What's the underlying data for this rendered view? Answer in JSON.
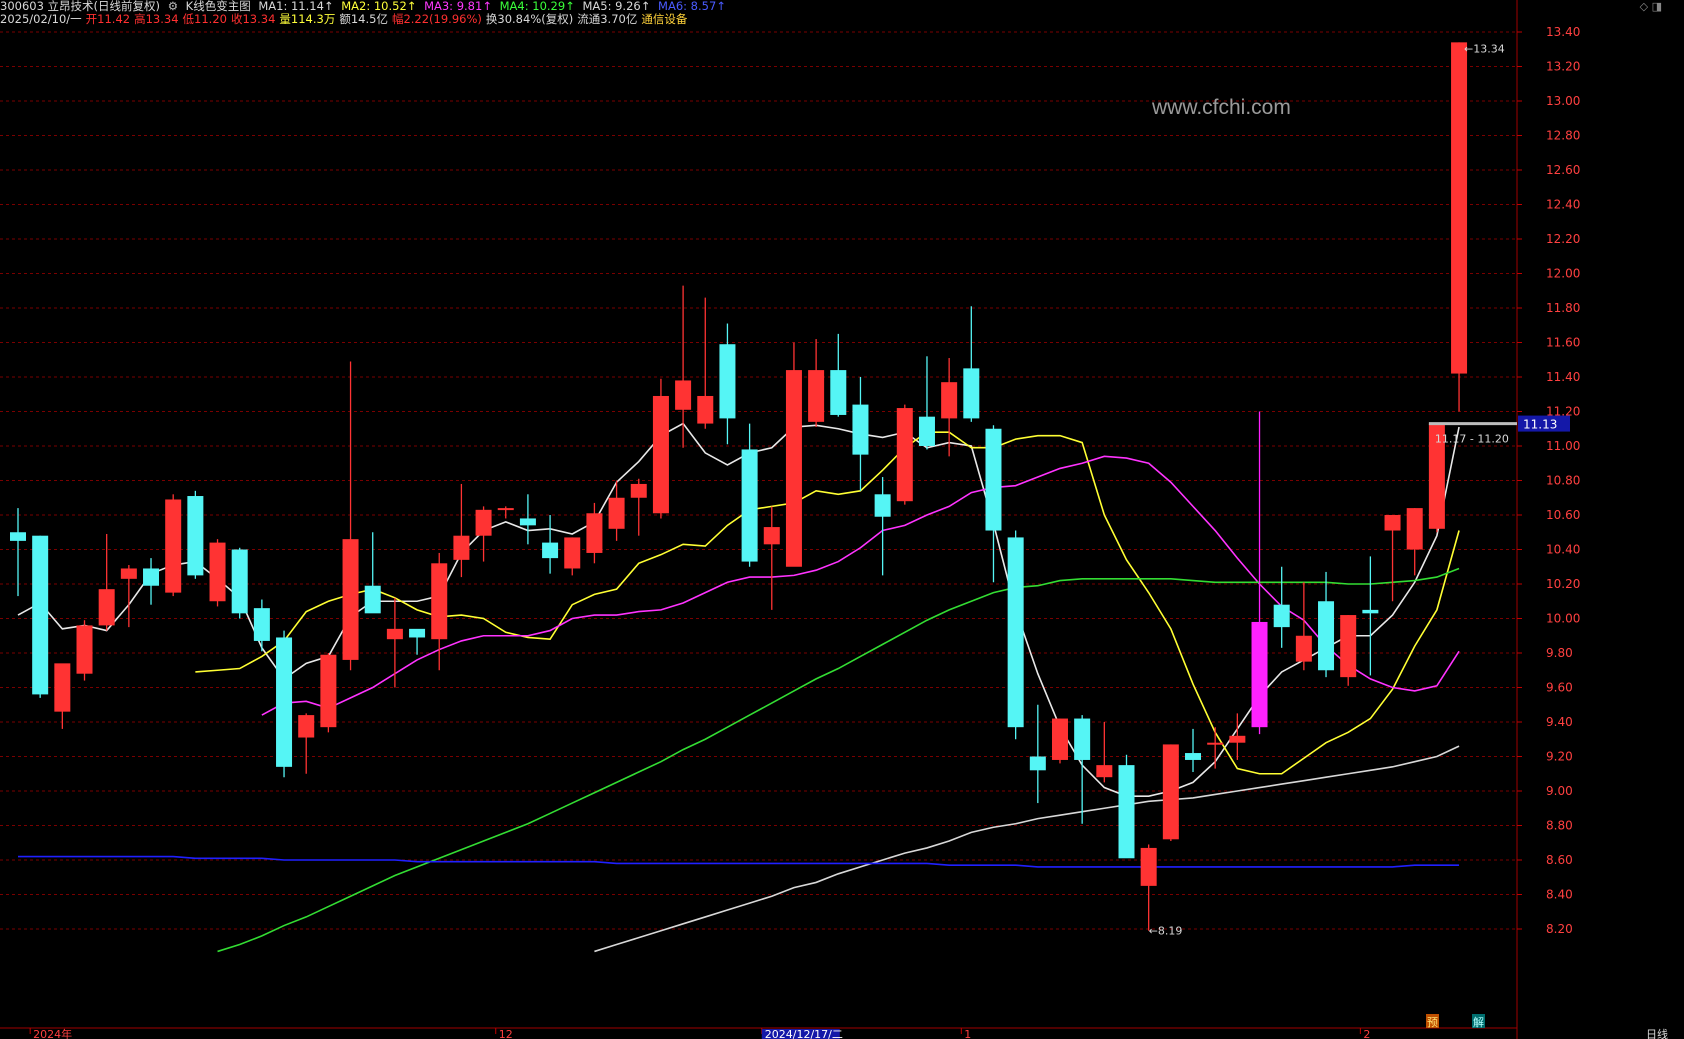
{
  "header": {
    "code_name": "300603 立昂技术(日线前复权)",
    "indicator_name": "K线色变主图",
    "ma_labels": [
      {
        "text": "MA1: 11.14↑",
        "color": "#d8d8d8"
      },
      {
        "text": "MA2: 10.52↑",
        "color": "#ffff3a"
      },
      {
        "text": "MA3: 9.81↑",
        "color": "#ff3aff"
      },
      {
        "text": "MA4: 10.29↑",
        "color": "#3aff3a"
      },
      {
        "text": "MA5: 9.26↑",
        "color": "#d8d8d8"
      },
      {
        "text": "MA6: 8.57↑",
        "color": "#4a5bff"
      }
    ],
    "date": "2025/02/10/一",
    "open": "开11.42",
    "high": "高13.34",
    "low": "低11.20",
    "close": "收13.34",
    "volume": "量114.3万",
    "amount": "额14.5亿",
    "change": "幅2.22(19.96%)",
    "turnover": "换30.84%(复权)",
    "float": "流通3.70亿",
    "sector": "通信设备"
  },
  "corner_icon": "diamond-icon",
  "watermark": "www.cfchi.com",
  "period_label": "日线",
  "colors": {
    "up": "#ff3333",
    "down": "#55f5f5",
    "special_up": "#ff22ff",
    "grid": "#7a0000",
    "axis_text": "#ff4040",
    "ma1": "#e8e8e8",
    "ma2": "#ffff33",
    "ma3": "#ff33ff",
    "ma4": "#33dd33",
    "ma5": "#d8d8d8",
    "ma6": "#2020ff"
  },
  "chart_data": {
    "type": "candlestick",
    "ylim": [
      8.1,
      13.5
    ],
    "y_ticks": [
      "13.40",
      "13.20",
      "13.00",
      "12.80",
      "12.60",
      "12.40",
      "12.20",
      "12.00",
      "11.80",
      "11.60",
      "11.40",
      "11.20",
      "11.00",
      "10.80",
      "10.60",
      "10.40",
      "10.20",
      "10.00",
      "9.80",
      "9.60",
      "9.40",
      "9.20",
      "9.00",
      "8.80",
      "8.60",
      "8.40",
      "8.20"
    ],
    "x_labels": [
      {
        "text": "2024年",
        "index": 1
      },
      {
        "text": "12",
        "index": 22
      },
      {
        "text": "2024/12/17/二",
        "index": 34
      },
      {
        "text": "1",
        "index": 43
      },
      {
        "text": "2",
        "index": 61
      }
    ],
    "annotations": {
      "high_marker": "13.34",
      "low_marker": "8.19",
      "current_price": "11.13",
      "range_text": "11.17 - 11.20",
      "badge_yu": "预",
      "badge_jie": "解"
    },
    "candles": [
      {
        "o": 10.5,
        "h": 10.64,
        "l": 10.13,
        "c": 10.45
      },
      {
        "o": 10.48,
        "h": 10.48,
        "l": 9.54,
        "c": 9.56
      },
      {
        "o": 9.46,
        "h": 9.73,
        "l": 9.36,
        "c": 9.74
      },
      {
        "o": 9.68,
        "h": 9.99,
        "l": 9.64,
        "c": 9.96
      },
      {
        "o": 9.96,
        "h": 10.49,
        "l": 9.93,
        "c": 10.17
      },
      {
        "o": 10.23,
        "h": 10.31,
        "l": 9.95,
        "c": 10.29
      },
      {
        "o": 10.29,
        "h": 10.35,
        "l": 10.08,
        "c": 10.19
      },
      {
        "o": 10.15,
        "h": 10.72,
        "l": 10.13,
        "c": 10.69
      },
      {
        "o": 10.71,
        "h": 10.74,
        "l": 10.23,
        "c": 10.25
      },
      {
        "o": 10.1,
        "h": 10.46,
        "l": 10.07,
        "c": 10.44
      },
      {
        "o": 10.4,
        "h": 10.41,
        "l": 10.0,
        "c": 10.03
      },
      {
        "o": 10.06,
        "h": 10.11,
        "l": 9.81,
        "c": 9.87
      },
      {
        "o": 9.89,
        "h": 9.93,
        "l": 9.08,
        "c": 9.14
      },
      {
        "o": 9.31,
        "h": 9.45,
        "l": 9.1,
        "c": 9.44
      },
      {
        "o": 9.37,
        "h": 9.8,
        "l": 9.34,
        "c": 9.79
      },
      {
        "o": 9.76,
        "h": 11.49,
        "l": 9.7,
        "c": 10.46
      },
      {
        "o": 10.19,
        "h": 10.5,
        "l": 10.04,
        "c": 10.03
      },
      {
        "o": 9.88,
        "h": 10.12,
        "l": 9.6,
        "c": 9.94
      },
      {
        "o": 9.94,
        "h": 9.91,
        "l": 9.79,
        "c": 9.89
      },
      {
        "o": 9.88,
        "h": 10.38,
        "l": 9.7,
        "c": 10.32
      },
      {
        "o": 10.34,
        "h": 10.78,
        "l": 10.24,
        "c": 10.48
      },
      {
        "o": 10.48,
        "h": 10.65,
        "l": 10.33,
        "c": 10.63
      },
      {
        "o": 10.63,
        "h": 10.65,
        "l": 10.58,
        "c": 10.64
      },
      {
        "o": 10.58,
        "h": 10.72,
        "l": 10.43,
        "c": 10.54
      },
      {
        "o": 10.44,
        "h": 10.6,
        "l": 10.26,
        "c": 10.35
      },
      {
        "o": 10.29,
        "h": 10.47,
        "l": 10.25,
        "c": 10.47
      },
      {
        "o": 10.38,
        "h": 10.67,
        "l": 10.32,
        "c": 10.61
      },
      {
        "o": 10.52,
        "h": 10.8,
        "l": 10.45,
        "c": 10.7
      },
      {
        "o": 10.7,
        "h": 10.81,
        "l": 10.48,
        "c": 10.78
      },
      {
        "o": 10.61,
        "h": 11.39,
        "l": 10.58,
        "c": 11.29
      },
      {
        "o": 11.21,
        "h": 11.93,
        "l": 10.99,
        "c": 11.38
      },
      {
        "o": 11.13,
        "h": 11.86,
        "l": 11.1,
        "c": 11.29
      },
      {
        "o": 11.59,
        "h": 11.71,
        "l": 11.01,
        "c": 11.16
      },
      {
        "o": 10.98,
        "h": 11.13,
        "l": 10.3,
        "c": 10.33
      },
      {
        "o": 10.43,
        "h": 10.65,
        "l": 10.05,
        "c": 10.53
      },
      {
        "o": 10.3,
        "h": 11.6,
        "l": 10.31,
        "c": 11.44
      },
      {
        "o": 11.14,
        "h": 11.62,
        "l": 11.11,
        "c": 11.44
      },
      {
        "o": 11.44,
        "h": 11.65,
        "l": 11.17,
        "c": 11.18
      },
      {
        "o": 11.24,
        "h": 11.4,
        "l": 10.74,
        "c": 10.95
      },
      {
        "o": 10.72,
        "h": 10.82,
        "l": 10.25,
        "c": 10.59
      },
      {
        "o": 10.68,
        "h": 11.24,
        "l": 10.66,
        "c": 11.22
      },
      {
        "o": 11.17,
        "h": 11.52,
        "l": 10.98,
        "c": 11.0
      },
      {
        "o": 11.16,
        "h": 11.51,
        "l": 10.94,
        "c": 11.37
      },
      {
        "o": 11.45,
        "h": 11.81,
        "l": 11.14,
        "c": 11.16
      },
      {
        "o": 11.1,
        "h": 11.12,
        "l": 10.21,
        "c": 10.51
      },
      {
        "o": 10.47,
        "h": 10.51,
        "l": 9.3,
        "c": 9.37
      },
      {
        "o": 9.2,
        "h": 9.5,
        "l": 8.93,
        "c": 9.12
      },
      {
        "o": 9.18,
        "h": 9.42,
        "l": 9.16,
        "c": 9.42
      },
      {
        "o": 9.42,
        "h": 9.44,
        "l": 8.81,
        "c": 9.18
      },
      {
        "o": 9.08,
        "h": 9.4,
        "l": 9.05,
        "c": 9.15
      },
      {
        "o": 9.15,
        "h": 9.21,
        "l": 8.64,
        "c": 8.61
      },
      {
        "o": 8.45,
        "h": 8.69,
        "l": 8.19,
        "c": 8.67
      },
      {
        "o": 8.72,
        "h": 9.27,
        "l": 8.71,
        "c": 9.27
      },
      {
        "o": 9.22,
        "h": 9.36,
        "l": 9.11,
        "c": 9.18
      },
      {
        "o": 9.28,
        "h": 9.37,
        "l": 9.13,
        "c": 9.28
      },
      {
        "o": 9.28,
        "h": 9.45,
        "l": 9.18,
        "c": 9.32
      },
      {
        "o": 9.37,
        "h": 11.2,
        "l": 9.33,
        "c": 9.98,
        "color": "magenta"
      },
      {
        "o": 10.08,
        "h": 10.3,
        "l": 9.83,
        "c": 9.95
      },
      {
        "o": 9.75,
        "h": 10.21,
        "l": 9.7,
        "c": 9.9
      },
      {
        "o": 10.1,
        "h": 10.27,
        "l": 9.66,
        "c": 9.7
      },
      {
        "o": 9.66,
        "h": 10.02,
        "l": 9.61,
        "c": 10.02
      },
      {
        "o": 10.05,
        "h": 10.36,
        "l": 9.67,
        "c": 10.03
      },
      {
        "o": 10.51,
        "h": 10.6,
        "l": 10.1,
        "c": 10.6
      },
      {
        "o": 10.4,
        "h": 10.64,
        "l": 10.25,
        "c": 10.64
      },
      {
        "o": 10.52,
        "h": 11.13,
        "l": 10.5,
        "c": 11.13
      },
      {
        "o": 11.42,
        "h": 13.34,
        "l": 11.2,
        "c": 13.34
      }
    ],
    "series": [
      {
        "name": "MA1",
        "values": [
          10.02,
          10.09,
          9.94,
          9.96,
          9.93,
          10.08,
          10.26,
          10.31,
          10.33,
          10.23,
          10.12,
          9.83,
          9.65,
          9.74,
          9.78,
          10.01,
          10.1,
          10.1,
          10.1,
          10.13,
          10.38,
          10.51,
          10.56,
          10.51,
          10.52,
          10.49,
          10.56,
          10.79,
          10.91,
          11.06,
          11.13,
          10.96,
          10.89,
          10.96,
          10.99,
          11.11,
          11.12,
          11.1,
          11.07,
          11.05,
          11.08,
          10.99,
          11.02,
          11.0,
          10.55,
          10.05,
          9.68,
          9.37,
          9.15,
          9.02,
          8.97,
          8.97,
          9.0,
          9.05,
          9.17,
          9.36,
          9.55,
          9.69,
          9.76,
          9.83,
          9.9,
          9.9,
          10.02,
          10.21,
          10.48,
          11.11
        ]
      },
      {
        "name": "MA2",
        "values": [
          9.69,
          9.7,
          9.71,
          9.78,
          9.87,
          10.04,
          10.1,
          10.14,
          10.17,
          10.12,
          10.05,
          10.01,
          10.02,
          10.0,
          9.92,
          9.89,
          9.88,
          10.08,
          10.14,
          10.17,
          10.32,
          10.37,
          10.43,
          10.42,
          10.54,
          10.63,
          10.65,
          10.67,
          10.74,
          10.72,
          10.74,
          10.86,
          10.99,
          11.08,
          11.08,
          10.99,
          10.99,
          11.04,
          11.06,
          11.06,
          11.02,
          10.6,
          10.34,
          10.15,
          9.94,
          9.62,
          9.34,
          9.13,
          9.1,
          9.1,
          9.19,
          9.28,
          9.34,
          9.42,
          9.59,
          9.84,
          10.05,
          10.51
        ]
      },
      {
        "name": "MA3",
        "values": [
          9.44,
          9.51,
          9.52,
          9.48,
          9.54,
          9.6,
          9.68,
          9.76,
          9.82,
          9.87,
          9.9,
          9.9,
          9.9,
          9.93,
          10.0,
          10.02,
          10.02,
          10.04,
          10.05,
          10.09,
          10.15,
          10.21,
          10.24,
          10.24,
          10.25,
          10.28,
          10.33,
          10.41,
          10.51,
          10.54,
          10.6,
          10.65,
          10.73,
          10.76,
          10.77,
          10.82,
          10.87,
          10.9,
          10.94,
          10.93,
          10.9,
          10.79,
          10.65,
          10.51,
          10.35,
          10.2,
          10.07,
          9.99,
          9.84,
          9.73,
          9.65,
          9.6,
          9.58,
          9.61,
          9.81
        ]
      },
      {
        "name": "MA4",
        "values": [
          8.07,
          8.11,
          8.16,
          8.22,
          8.27,
          8.33,
          8.39,
          8.45,
          8.51,
          8.56,
          8.61,
          8.66,
          8.71,
          8.76,
          8.81,
          8.87,
          8.93,
          8.99,
          9.05,
          9.11,
          9.17,
          9.24,
          9.3,
          9.37,
          9.44,
          9.51,
          9.58,
          9.65,
          9.71,
          9.78,
          9.85,
          9.92,
          9.99,
          10.05,
          10.1,
          10.15,
          10.18,
          10.19,
          10.22,
          10.23,
          10.23,
          10.23,
          10.23,
          10.23,
          10.22,
          10.21,
          10.21,
          10.21,
          10.21,
          10.21,
          10.21,
          10.2,
          10.2,
          10.21,
          10.22,
          10.24,
          10.29
        ]
      },
      {
        "name": "MA5",
        "values": [
          8.07,
          8.11,
          8.15,
          8.19,
          8.23,
          8.27,
          8.31,
          8.35,
          8.39,
          8.44,
          8.47,
          8.52,
          8.56,
          8.6,
          8.64,
          8.67,
          8.71,
          8.76,
          8.79,
          8.81,
          8.84,
          8.86,
          8.88,
          8.9,
          8.92,
          8.94,
          8.95,
          8.96,
          8.98,
          9.0,
          9.02,
          9.04,
          9.06,
          9.08,
          9.1,
          9.12,
          9.14,
          9.17,
          9.2,
          9.26
        ]
      },
      {
        "name": "MA6",
        "values": [
          8.62,
          8.62,
          8.62,
          8.62,
          8.62,
          8.62,
          8.62,
          8.62,
          8.61,
          8.61,
          8.61,
          8.61,
          8.6,
          8.6,
          8.6,
          8.6,
          8.6,
          8.6,
          8.59,
          8.59,
          8.59,
          8.59,
          8.59,
          8.59,
          8.59,
          8.59,
          8.59,
          8.58,
          8.58,
          8.58,
          8.58,
          8.58,
          8.58,
          8.58,
          8.58,
          8.58,
          8.58,
          8.58,
          8.58,
          8.58,
          8.58,
          8.58,
          8.57,
          8.57,
          8.57,
          8.57,
          8.56,
          8.56,
          8.56,
          8.56,
          8.56,
          8.56,
          8.56,
          8.56,
          8.56,
          8.56,
          8.56,
          8.56,
          8.56,
          8.56,
          8.56,
          8.56,
          8.56,
          8.57,
          8.57,
          8.57
        ]
      }
    ]
  }
}
